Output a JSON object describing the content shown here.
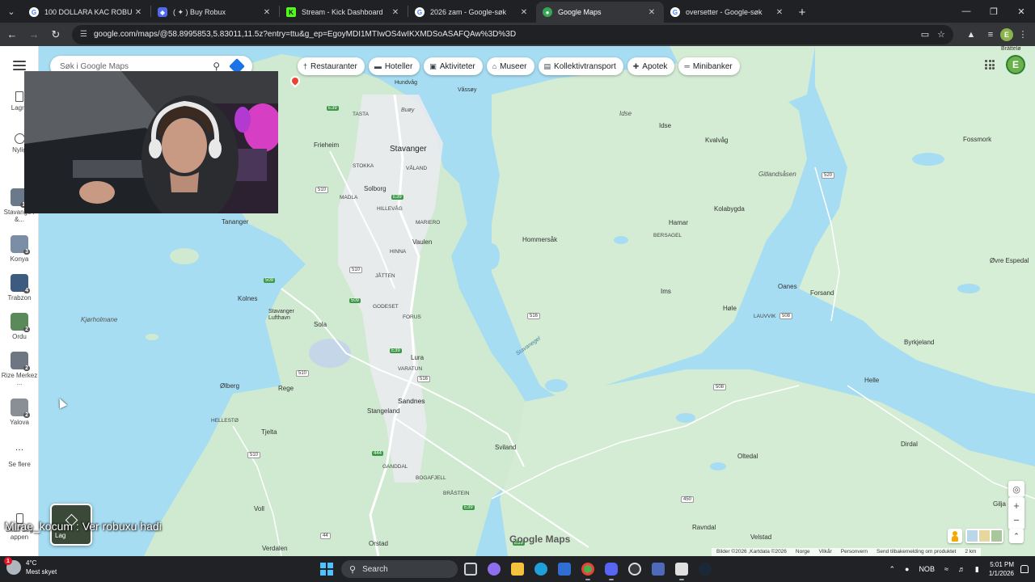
{
  "browser": {
    "tabs": [
      {
        "title": "100 DOLLARA KAC ROBUX ALIN",
        "active": false,
        "favicon_color": "#ffffff"
      },
      {
        "title": "( ✦ ) Buy Robux",
        "active": false,
        "favicon_color": "#4f6bed"
      },
      {
        "title": "Stream - Kick Dashboard",
        "active": false,
        "favicon_color": "#53fc18"
      },
      {
        "title": "2026 zam - Google-søk",
        "active": false,
        "favicon_color": "#ffffff"
      },
      {
        "title": "Google Maps",
        "active": true,
        "favicon_color": "#34a853"
      },
      {
        "title": "oversetter - Google-søk",
        "active": false,
        "favicon_color": "#ffffff"
      }
    ],
    "new_tab": "+",
    "url": "google.com/maps/@58.8995853,5.83011,11.5z?entry=ttu&g_ep=EgoyMDI1MTIwOS4wIKXMDSoASAFQAw%3D%3D",
    "profile_letter": "E"
  },
  "maps": {
    "search_placeholder": "Søk i Google Maps",
    "chips": [
      {
        "label": "Restauranter",
        "icon": "fork-knife-icon",
        "glyph": "†"
      },
      {
        "label": "Hoteller",
        "icon": "bed-icon",
        "glyph": "▬"
      },
      {
        "label": "Aktiviteter",
        "icon": "camera-icon",
        "glyph": "▣"
      },
      {
        "label": "Museer",
        "icon": "museum-icon",
        "glyph": "⌂"
      },
      {
        "label": "Kollektivtransport",
        "icon": "bus-icon",
        "glyph": "▤"
      },
      {
        "label": "Apotek",
        "icon": "pharmacy-icon",
        "glyph": "✚"
      },
      {
        "label": "Minibanker",
        "icon": "atm-icon",
        "glyph": "═"
      }
    ],
    "rail": {
      "saved": "Lagre",
      "recent": "Nylig",
      "recents": [
        {
          "label": "Stavange r &...",
          "badge": "10"
        },
        {
          "label": "Konya",
          "badge": "3"
        },
        {
          "label": "Trabzon",
          "badge": "4"
        },
        {
          "label": "Ordu",
          "badge": "2"
        },
        {
          "label": "Rize Merkez ...",
          "badge": "2"
        },
        {
          "label": "Yalova",
          "badge": "2"
        }
      ],
      "more": "Se flere",
      "app": "Skaff deg appen"
    },
    "layers_label": "Lag",
    "logo": "Google Maps",
    "footer": [
      "Bilder ©2026 ,Kartdata ©2026",
      "Norge",
      "Vilkår",
      "Personvern",
      "Send tilbakemelding om produktet",
      "2 km"
    ],
    "place_labels": [
      {
        "text": "Hundvåg",
        "italic": false
      },
      {
        "text": "Våssøy",
        "italic": false
      },
      {
        "text": "Buøy",
        "italic": true
      },
      {
        "text": "Idse",
        "italic": true
      },
      {
        "text": "Idse",
        "italic": false
      },
      {
        "text": "Bråttelø",
        "italic": false
      },
      {
        "text": "TASTA",
        "italic": false
      },
      {
        "text": "Stavanger",
        "italic": false
      },
      {
        "text": "Kvalvåg",
        "italic": false
      },
      {
        "text": "Fossmork",
        "italic": false
      },
      {
        "text": "Frieheim",
        "italic": false
      },
      {
        "text": "STOKKA",
        "italic": false
      },
      {
        "text": "VÅLAND",
        "italic": false
      },
      {
        "text": "Gitlandsåsen",
        "italic": true
      },
      {
        "text": "Solborg",
        "italic": false
      },
      {
        "text": "MADLA",
        "italic": false
      },
      {
        "text": "HILLEVÅG",
        "italic": false
      },
      {
        "text": "Kolabygda",
        "italic": false
      },
      {
        "text": "Tananger",
        "italic": false
      },
      {
        "text": "MARIERO",
        "italic": false
      },
      {
        "text": "Hamar",
        "italic": false
      },
      {
        "text": "BERSAGEL",
        "italic": false
      },
      {
        "text": "Hommersåk",
        "italic": false
      },
      {
        "text": "Vaulen",
        "italic": false
      },
      {
        "text": "Øvre Espedal",
        "italic": false
      },
      {
        "text": "HINNA",
        "italic": false
      },
      {
        "text": "JÅTTEN",
        "italic": false
      },
      {
        "text": "Oanes",
        "italic": false
      },
      {
        "text": "Kolnes",
        "italic": false
      },
      {
        "text": "Ims",
        "italic": false
      },
      {
        "text": "Forsand",
        "italic": false
      },
      {
        "text": "GODESET",
        "italic": false
      },
      {
        "text": "Stavanger Lufthavn",
        "italic": false
      },
      {
        "text": "Høle",
        "italic": false
      },
      {
        "text": "LAUVVIK",
        "italic": false
      },
      {
        "text": "Kjørholmane",
        "italic": true
      },
      {
        "text": "FORUS",
        "italic": false
      },
      {
        "text": "Sola",
        "italic": false
      },
      {
        "text": "Byrkjeland",
        "italic": false
      },
      {
        "text": "Stavanegel",
        "italic": true
      },
      {
        "text": "Lura",
        "italic": false
      },
      {
        "text": "VARATUN",
        "italic": false
      },
      {
        "text": "Helle",
        "italic": false
      },
      {
        "text": "Ølberg",
        "italic": false
      },
      {
        "text": "Rege",
        "italic": false
      },
      {
        "text": "Sandnes",
        "italic": false
      },
      {
        "text": "HELLESTØ",
        "italic": false
      },
      {
        "text": "Stangeland",
        "italic": false
      },
      {
        "text": "Tjelta",
        "italic": false
      },
      {
        "text": "Dirdal",
        "italic": false
      },
      {
        "text": "Sviland",
        "italic": false
      },
      {
        "text": "Oltedal",
        "italic": false
      },
      {
        "text": "GANDDAL",
        "italic": false
      },
      {
        "text": "BOGAFJELL",
        "italic": false
      },
      {
        "text": "BRÅSTEIN",
        "italic": false
      },
      {
        "text": "Voll",
        "italic": false
      },
      {
        "text": "Ravndal",
        "italic": false
      },
      {
        "text": "Gilja",
        "italic": false
      },
      {
        "text": "Orstad",
        "italic": false
      },
      {
        "text": "Verdalen",
        "italic": false
      },
      {
        "text": "Velstad",
        "italic": false
      }
    ],
    "road_shields": [
      "E39",
      "E39",
      "509",
      "510",
      "509",
      "510",
      "516",
      "510",
      "E39",
      "444",
      "516",
      "508",
      "508",
      "520",
      "450",
      "510",
      "44",
      "E39",
      "E39"
    ]
  },
  "overlay_text": "Mirae_kocum : Ver robuxu hadi",
  "taskbar": {
    "weather_badge": "1",
    "weather_temp": "4°C",
    "weather_desc": "Mest skyet",
    "search_label": "Search",
    "language": "NOB",
    "time": "5:01 PM",
    "date": "1/1/2026"
  }
}
